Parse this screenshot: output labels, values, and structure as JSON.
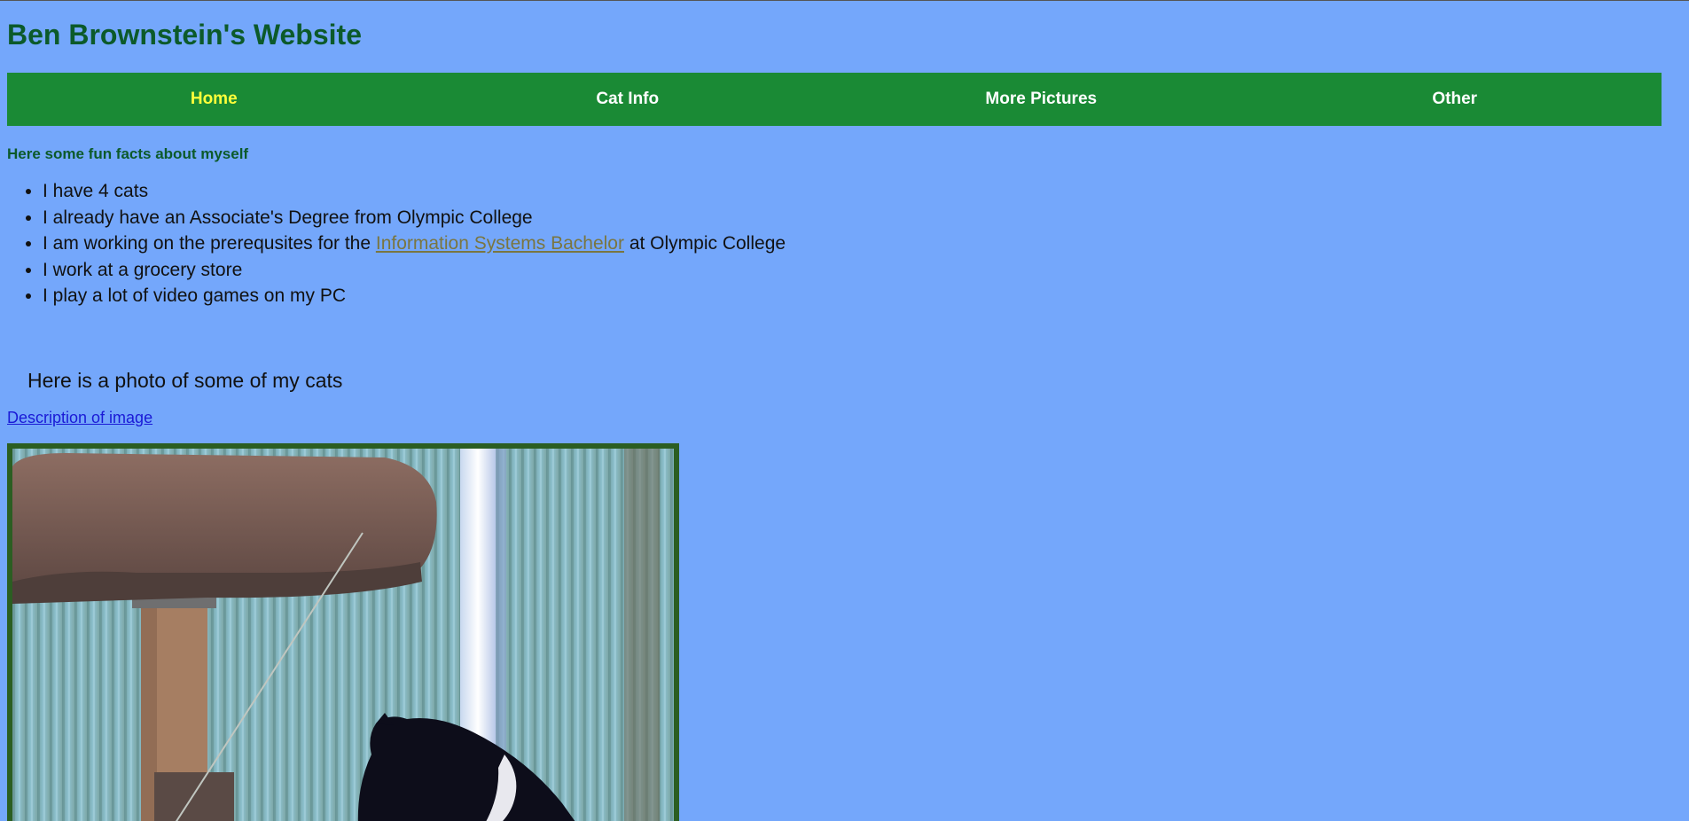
{
  "site": {
    "title": "Ben Brownstein's Website"
  },
  "nav": {
    "items": [
      {
        "label": "Home",
        "active": true
      },
      {
        "label": "Cat Info",
        "active": false
      },
      {
        "label": "More Pictures",
        "active": false
      },
      {
        "label": "Other",
        "active": false
      }
    ]
  },
  "main": {
    "facts_heading": "Here some fun facts about myself",
    "facts": {
      "item1": "I have 4 cats",
      "item2": "I already have an Associate's Degree from Olympic College",
      "item3_before": "I am working on the prerequsites for the ",
      "item3_link": "Information Systems Bachelor",
      "item3_after": " at Olympic College",
      "item4": "I work at a grocery store",
      "item5": "I play a lot of video games on my PC"
    },
    "photo_caption": "Here is a photo of some of my cats",
    "description_link": "Description of image"
  },
  "colors": {
    "background": "#74a7fb",
    "title_text": "#0c5a2a",
    "nav_background": "#1a8a35",
    "nav_active_text": "#ffff3a",
    "link_visited": "#7a7640",
    "link": "#1a1ad6",
    "photo_border": "#2b5e22"
  }
}
